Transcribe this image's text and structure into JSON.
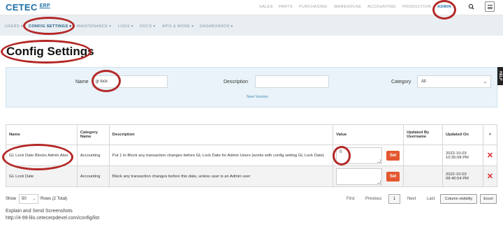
{
  "app": {
    "logo": "CETEC",
    "logo_sup": "ERP"
  },
  "topnav": {
    "items": [
      "SALES",
      "PARTS",
      "PURCHASING",
      "WAREHOUSE",
      "ACCOUNTING",
      "PRODUCTION",
      "ADMIN"
    ],
    "active": "ADMIN",
    "search_icon": "search-icon",
    "menu_icon": "hamburger-menu-icon"
  },
  "subnav": {
    "items": [
      "USERS ▾",
      "CONFIG SETTINGS ▾",
      "MAINTENANCE ▾",
      "LOGS ▾",
      "DOCS ▾",
      "APIS & MORE ▾",
      "DASHBOARDS ▾"
    ],
    "active": "CONFIG SETTINGS ▾"
  },
  "page_title": "Config Settings",
  "filters": {
    "name_label": "Name",
    "name_value": "gl lock",
    "description_label": "Description",
    "description_value": "",
    "category_label": "Category",
    "category_value": "All",
    "new_version": "New Version"
  },
  "table": {
    "headers": [
      "Name",
      "Category Name",
      "Description",
      "Value",
      "Updated By Username",
      "Updated On"
    ],
    "sort_caret": "▾",
    "set_label": "Set",
    "rows": [
      {
        "name": "GL Lock Date Blocks Admin Also",
        "category": "Accounting",
        "description": "Put 1 to Block any transaction changes before GL Lock Date for Admin Users (works with config setting GL Lock Date)",
        "value": "0",
        "updated_by": "",
        "updated_on": "2022-10-03 10:35:08 PM"
      },
      {
        "name": "GL Lock Date",
        "category": "Accounting",
        "description": "Block any transaction changes before this date, unless user is an Admin user",
        "value": "",
        "updated_by": "",
        "updated_on": "2022-10-03 08:40:54 PM"
      }
    ]
  },
  "footer": {
    "show_label": "Show",
    "show_value": "50",
    "rows_label": "Rows",
    "total": "(2 Total)",
    "first": "First",
    "previous": "Previous",
    "page": "1",
    "next": "Next",
    "last": "Last",
    "column_visibility": "Column visibility",
    "excel": "Excel"
  },
  "help_tab": "HELP",
  "caption": {
    "line1": "Explain and Send Screenshots",
    "line2": "http://4-99-lilo.cetecerpdevel.com/config/list"
  },
  "colors": {
    "brand": "#1e6fa8",
    "set_button": "#e4572e",
    "delete": "#d9262b",
    "highlight_circle": "#b42828"
  }
}
